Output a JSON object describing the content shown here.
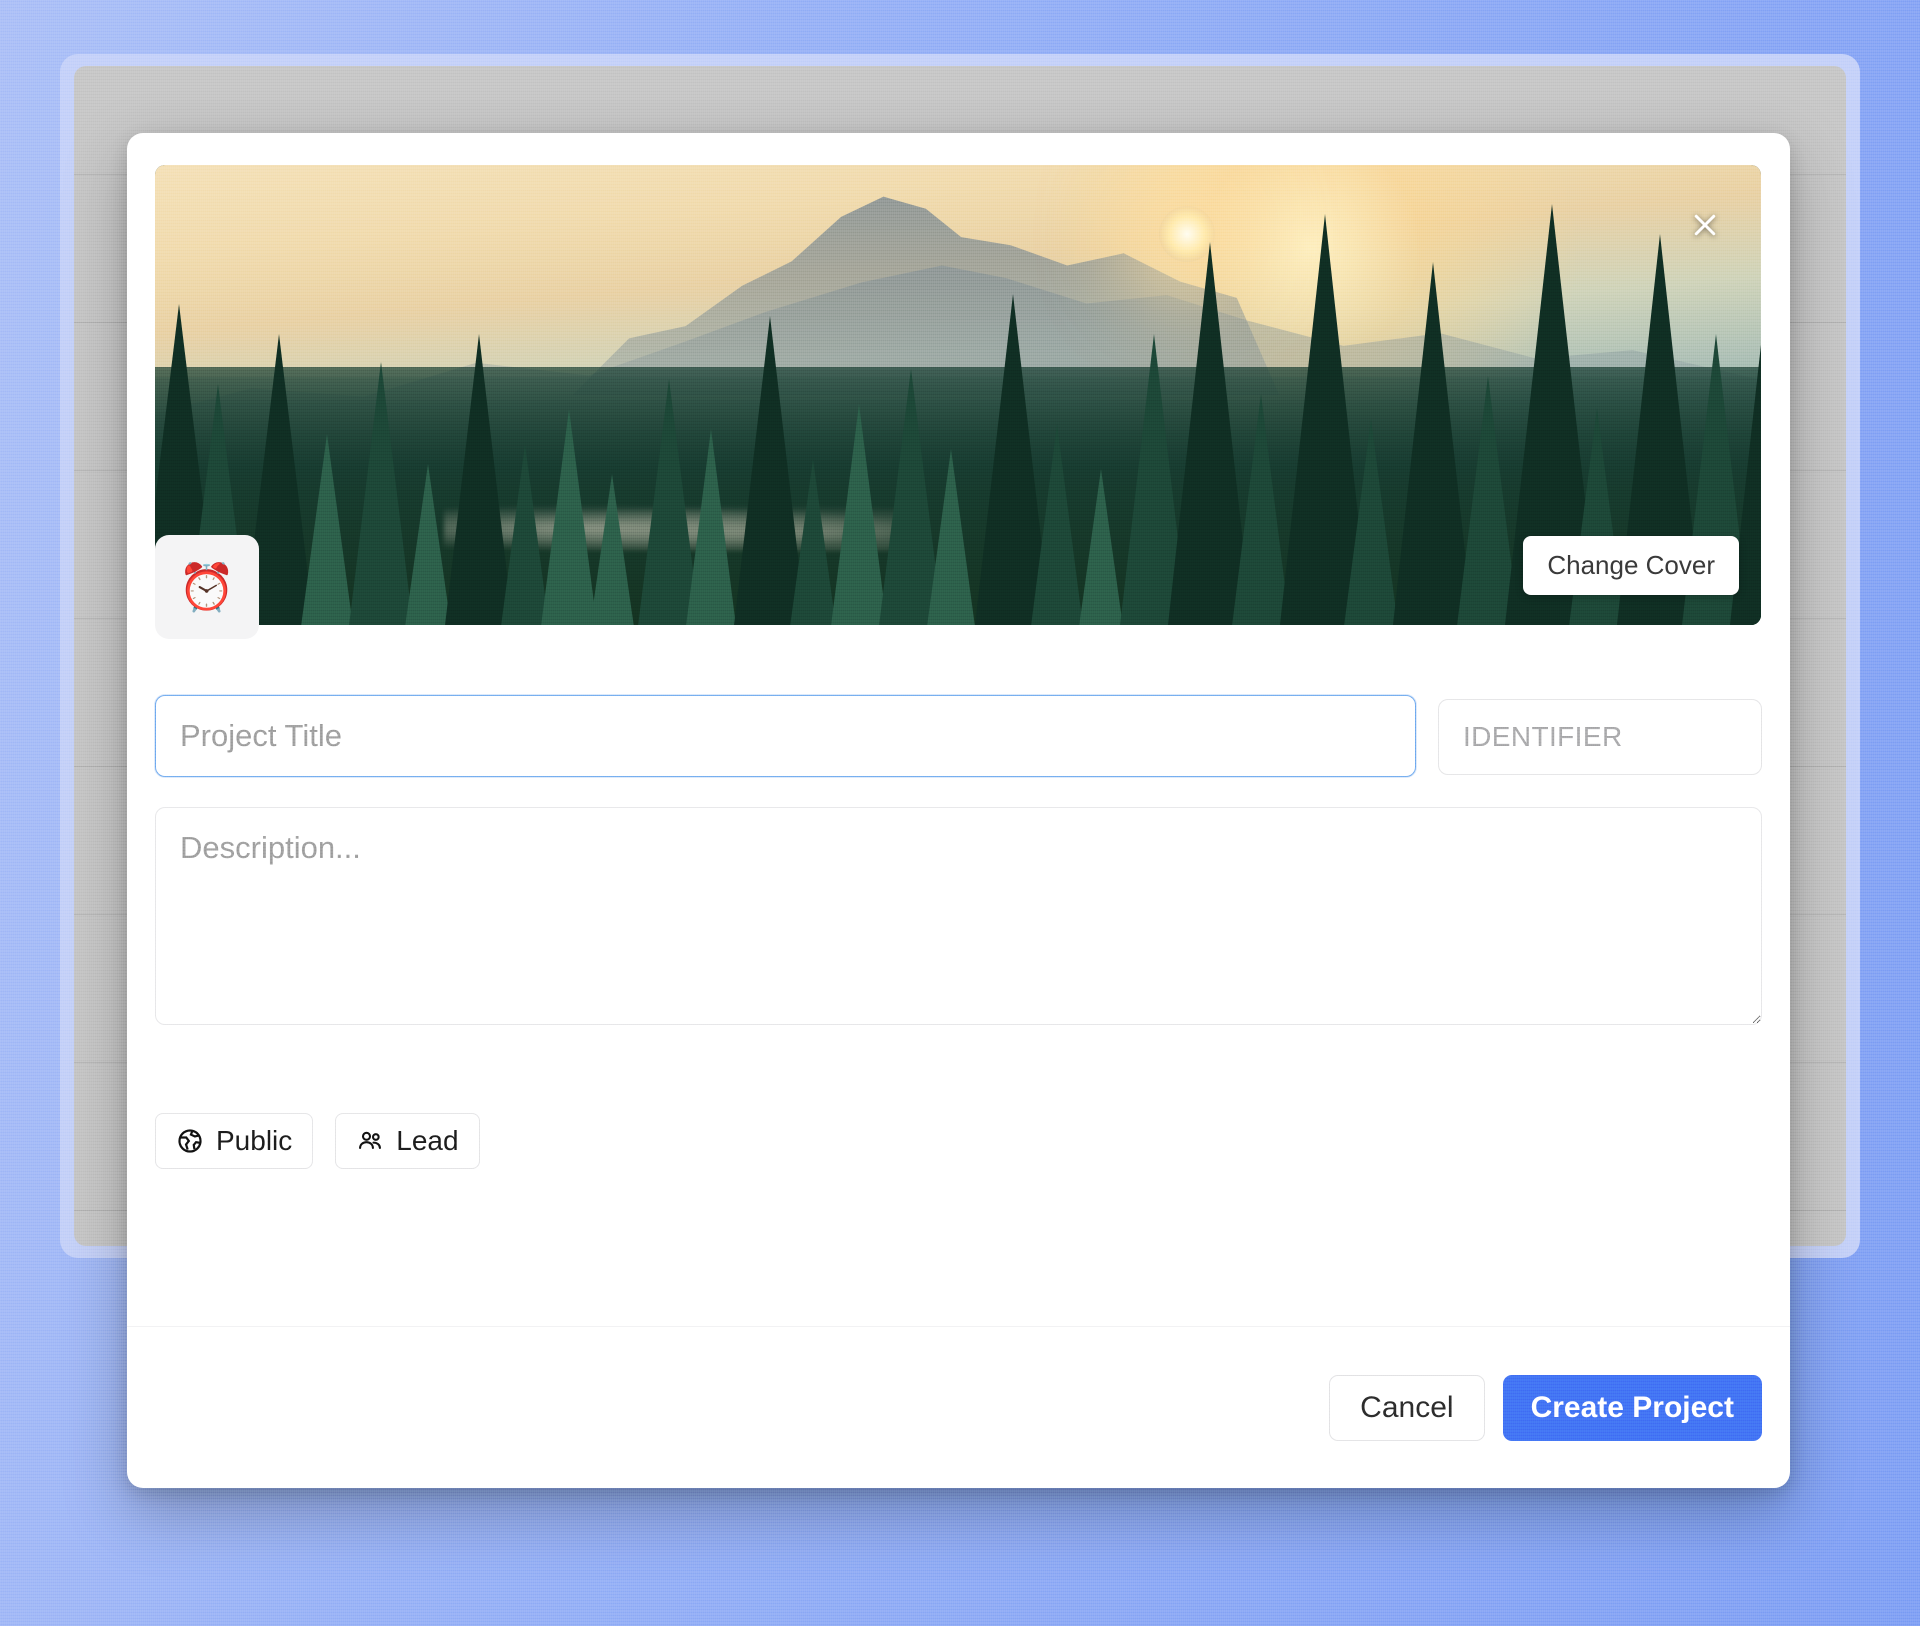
{
  "theme": {
    "page_background": "#93aef6",
    "frame_outline": "#c2cff9",
    "app_backdrop": "#c4c4c4",
    "modal_background": "#ffffff",
    "accent": "#3f6ef4",
    "focus_border": "#6ea8ee",
    "placeholder_text": "#9b9b9b",
    "chip_border": "#e4e4e6"
  },
  "cover": {
    "alt": "Mountain sunset with conifer forest and lake",
    "close_label": "Close",
    "change_cover_label": "Change Cover"
  },
  "icon_picker": {
    "emoji": "⏰",
    "name": "alarm-clock-emoji"
  },
  "form": {
    "title": {
      "value": "",
      "placeholder": "Project Title"
    },
    "identifier": {
      "value": "",
      "placeholder": "IDENTIFIER"
    },
    "description": {
      "value": "",
      "placeholder": "Description..."
    },
    "properties": [
      {
        "label": "Public",
        "icon": "globe-icon"
      },
      {
        "label": "Lead",
        "icon": "users-icon"
      }
    ]
  },
  "footer": {
    "cancel_label": "Cancel",
    "create_label": "Create Project"
  }
}
